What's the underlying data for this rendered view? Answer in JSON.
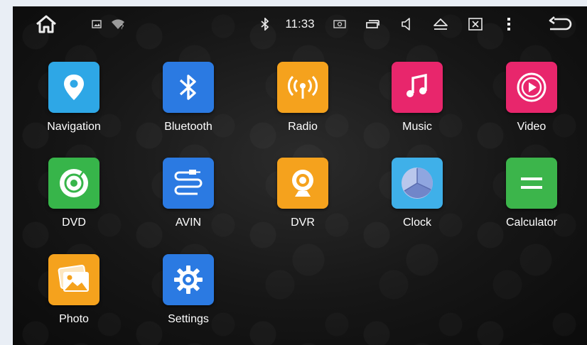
{
  "status_bar": {
    "time": "11:33",
    "icons": [
      "home-icon",
      "image-icon",
      "wifi-unknown-icon",
      "bluetooth-icon",
      "screenshot-icon",
      "recent-apps-icon",
      "volume-icon",
      "eject-icon",
      "close-window-icon",
      "more-vert-icon",
      "back-icon"
    ]
  },
  "apps": [
    {
      "label": "Navigation",
      "color": "#2ea7e6",
      "icon": "location-pin-icon"
    },
    {
      "label": "Bluetooth",
      "color": "#2b7ae2",
      "icon": "bluetooth-icon"
    },
    {
      "label": "Radio",
      "color": "#f5a21d",
      "icon": "radio-icon"
    },
    {
      "label": "Music",
      "color": "#e8266c",
      "icon": "music-note-icon"
    },
    {
      "label": "Video",
      "color": "#e8266c",
      "icon": "play-circle-icon"
    },
    {
      "label": "DVD",
      "color": "#37b54a",
      "icon": "disc-icon"
    },
    {
      "label": "AVIN",
      "color": "#2b7ae2",
      "icon": "cable-icon"
    },
    {
      "label": "DVR",
      "color": "#f5a21d",
      "icon": "webcam-icon"
    },
    {
      "label": "Clock",
      "color": "#3fb0e9",
      "icon": "clock-icon"
    },
    {
      "label": "Calculator",
      "color": "#3cb54b",
      "icon": "equals-icon"
    },
    {
      "label": "Photo",
      "color": "#f5a21d",
      "icon": "photo-icon"
    },
    {
      "label": "Settings",
      "color": "#2b7ae2",
      "icon": "gear-icon"
    }
  ]
}
